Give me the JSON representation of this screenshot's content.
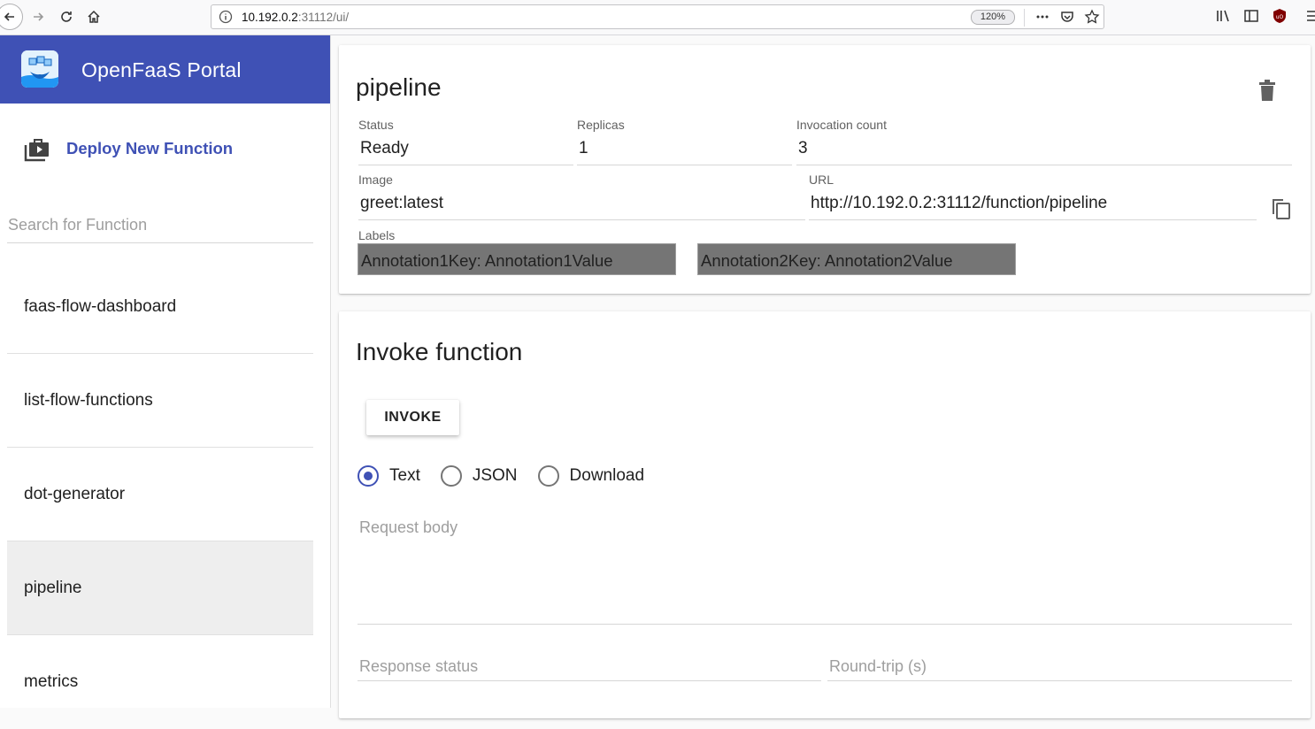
{
  "browser": {
    "url_host": "10.192.0.2",
    "url_rest": ":31112/ui/",
    "zoom": "120%"
  },
  "sidebar": {
    "title": "OpenFaaS Portal",
    "deploy_label": "Deploy New Function",
    "search_placeholder": "Search for Function",
    "functions": [
      {
        "name": "faas-flow-dashboard",
        "active": false
      },
      {
        "name": "list-flow-functions",
        "active": false
      },
      {
        "name": "dot-generator",
        "active": false
      },
      {
        "name": "pipeline",
        "active": true
      },
      {
        "name": "metrics",
        "active": false
      }
    ]
  },
  "detail": {
    "name": "pipeline",
    "status_label": "Status",
    "status": "Ready",
    "replicas_label": "Replicas",
    "replicas": "1",
    "invocations_label": "Invocation count",
    "invocations": "3",
    "image_label": "Image",
    "image": "greet:latest",
    "url_label": "URL",
    "url": "http://10.192.0.2:31112/function/pipeline",
    "labels_label": "Labels",
    "labels": [
      "Annotation1Key: Annotation1Value",
      "Annotation2Key: Annotation2Value"
    ]
  },
  "invoke": {
    "title": "Invoke function",
    "button": "INVOKE",
    "options": [
      "Text",
      "JSON",
      "Download"
    ],
    "selected": "Text",
    "request_placeholder": "Request body",
    "status_placeholder": "Response status",
    "roundtrip_placeholder": "Round-trip (s)"
  },
  "colors": {
    "primary": "#3f51b5",
    "chip": "#757575",
    "active_item": "#eeeeee"
  }
}
